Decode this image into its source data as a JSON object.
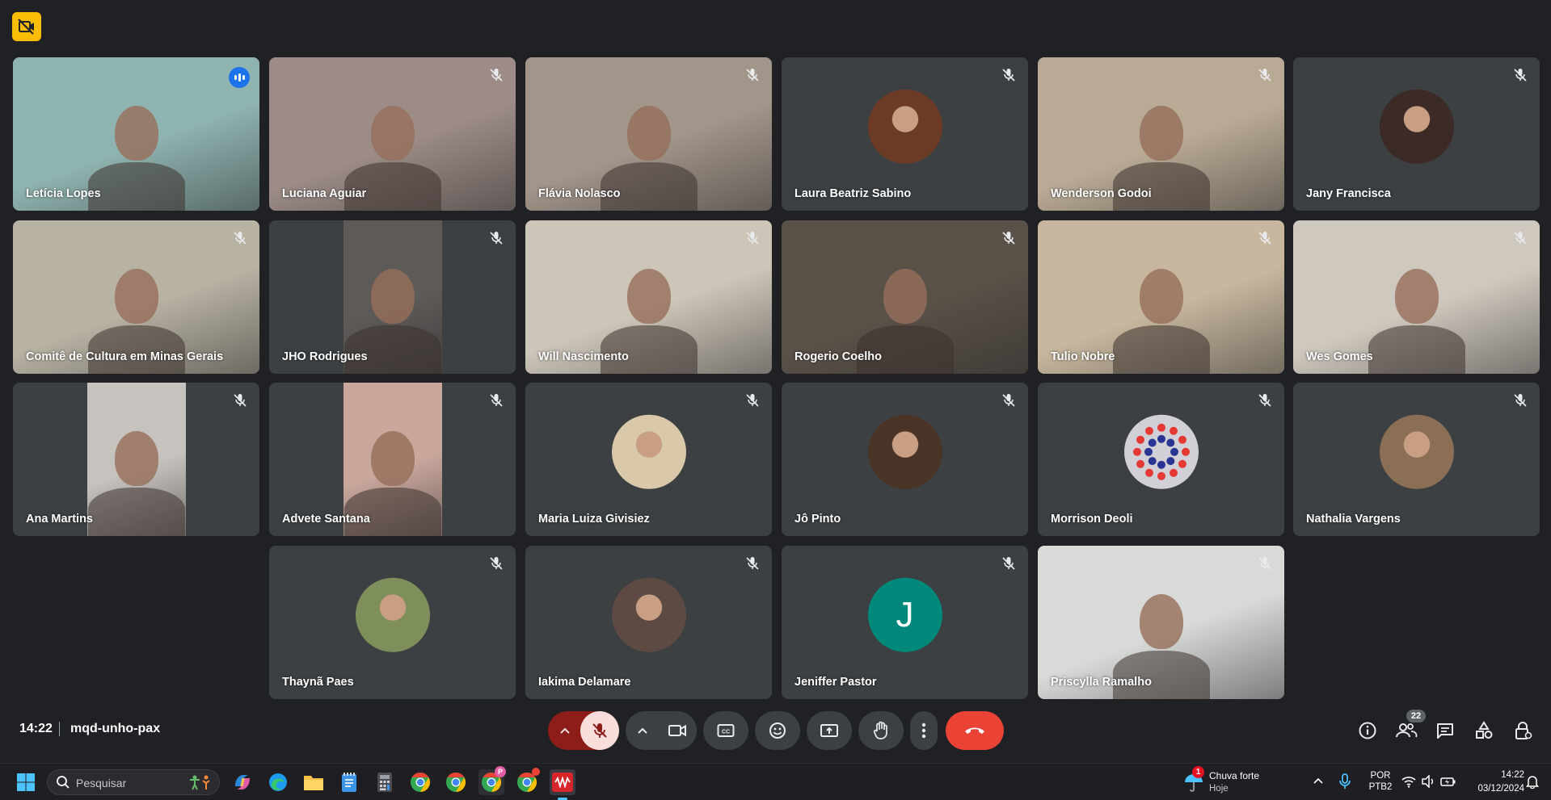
{
  "meeting": {
    "time": "14:22",
    "code": "mqd-unho-pax",
    "participants_count": "22"
  },
  "tiles": [
    {
      "name": "Letícia Lopes",
      "kind": "video",
      "speaking": true,
      "bg": "#8fb3b0"
    },
    {
      "name": "Luciana Aguiar",
      "kind": "video",
      "bg": "#9c8b86"
    },
    {
      "name": "Flávia Nolasco",
      "kind": "video",
      "bg": "#a2958a"
    },
    {
      "name": "Laura Beatriz Sabino",
      "kind": "avatar",
      "bg": "#6b3b26"
    },
    {
      "name": "Wenderson Godoi",
      "kind": "video",
      "bg": "#b9aa95"
    },
    {
      "name": "Jany Francisca",
      "kind": "avatar",
      "bg": "#3b2a26"
    },
    {
      "name": "Comitê de Cultura em Minas Gerais",
      "kind": "video",
      "bg": "#b8b2a3"
    },
    {
      "name": "JHO Rodrigues",
      "kind": "video-narrow",
      "bg": "#5d5a58"
    },
    {
      "name": "Will Nascimento",
      "kind": "video",
      "bg": "#cdc5b8"
    },
    {
      "name": "Rogerio Coelho",
      "kind": "video",
      "bg": "#5a5148"
    },
    {
      "name": "Tulio Nobre",
      "kind": "video",
      "bg": "#c7b79e"
    },
    {
      "name": "Wes Gomes",
      "kind": "video",
      "bg": "#cfc8be"
    },
    {
      "name": "Ana Martins",
      "kind": "video-narrow",
      "bg": "#c6c2bd"
    },
    {
      "name": "Advete Santana",
      "kind": "video-narrow",
      "bg": "#c9a79d"
    },
    {
      "name": "Maria Luiza Givisiez",
      "kind": "avatar",
      "bg": "#d9c8a9"
    },
    {
      "name": "Jô Pinto",
      "kind": "avatar",
      "bg": "#4a3427"
    },
    {
      "name": "Morrison Deoli",
      "kind": "logo",
      "bg": "#d0d0d6"
    },
    {
      "name": "Nathalia Vargens",
      "kind": "avatar",
      "bg": "#8a6e55"
    },
    {
      "name": "Thaynã Paes",
      "kind": "avatar",
      "bg": "#7f8f5c"
    },
    {
      "name": "Iakima Delamare",
      "kind": "avatar",
      "bg": "#5c4a43"
    },
    {
      "name": "Jeniffer Pastor",
      "kind": "letter",
      "letter": "J",
      "bg": "#00897b"
    },
    {
      "name": "Priscylla Ramalho",
      "kind": "video",
      "bg": "#d8dad8"
    }
  ],
  "controls": {
    "mic": "mic-off-icon",
    "camera": "camera-icon",
    "captions": "closed-captions-icon",
    "reactions": "emoji-icon",
    "present": "present-screen-icon",
    "raise_hand": "hand-icon",
    "more": "more-vert-icon",
    "leave": "end-call-icon",
    "leave_color": "#ea4335"
  },
  "taskbar": {
    "search_placeholder": "Pesquisar",
    "weather_text": "Chuva forte",
    "weather_sub": "Hoje",
    "weather_badge": "1",
    "lang_top": "POR",
    "lang_bottom": "PTB2",
    "clock_time": "14:22",
    "clock_date": "03/12/2024",
    "chrome_badge": "P"
  }
}
